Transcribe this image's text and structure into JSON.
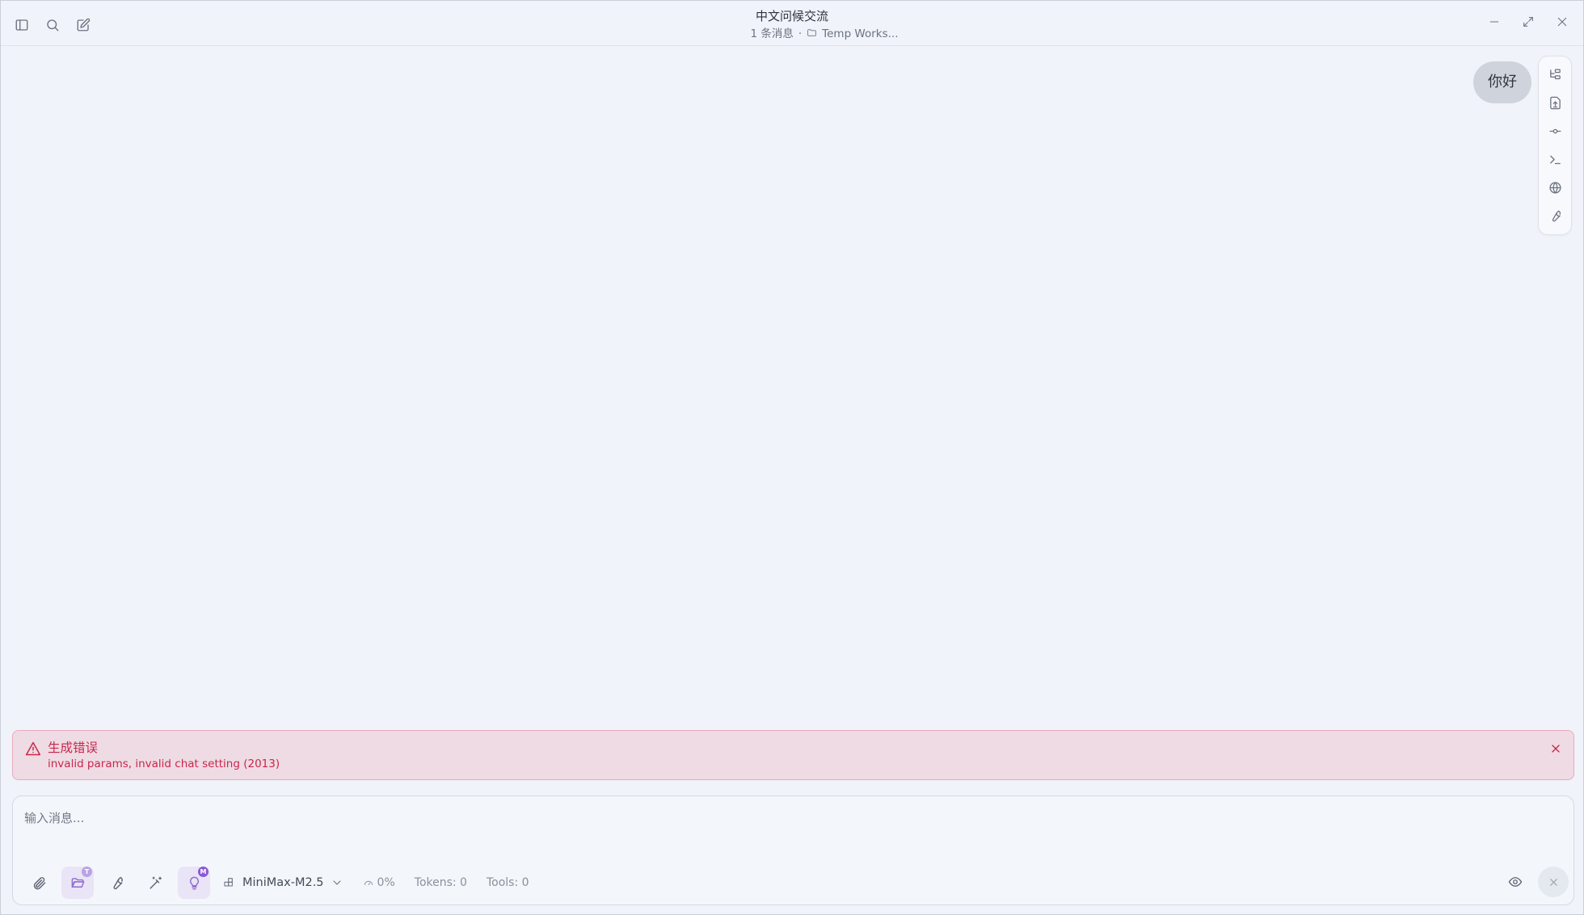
{
  "window": {
    "title": "中文问候交流",
    "message_count": "1 条消息",
    "separator": "·",
    "workspace": "Temp Works..."
  },
  "messages": [
    {
      "role": "user",
      "text": "你好"
    }
  ],
  "error": {
    "title": "生成错误",
    "message": "invalid params, invalid chat setting (2013)",
    "color": "#c8264e"
  },
  "composer": {
    "placeholder": "输入消息...",
    "model": "MiniMax-M2.5",
    "context_usage": "0%",
    "tokens": "Tokens: 0",
    "tools": "Tools: 0",
    "workspace_badge": "T",
    "think_badge": "M"
  },
  "icons": {
    "titlebar_left": [
      "sidebar-toggle-icon",
      "search-icon",
      "new-chat-icon"
    ],
    "window_controls": [
      "minimize-icon",
      "maximize-icon",
      "close-icon"
    ],
    "right_tools": [
      "tree-icon",
      "file-upload-icon",
      "commit-icon",
      "terminal-icon",
      "globe-icon",
      "wrench-icon"
    ]
  },
  "colors": {
    "background": "#f0f3f9",
    "bubble": "#cfd4dc",
    "accent": "#8f6bd1",
    "error_bg": "#efdbe3"
  }
}
